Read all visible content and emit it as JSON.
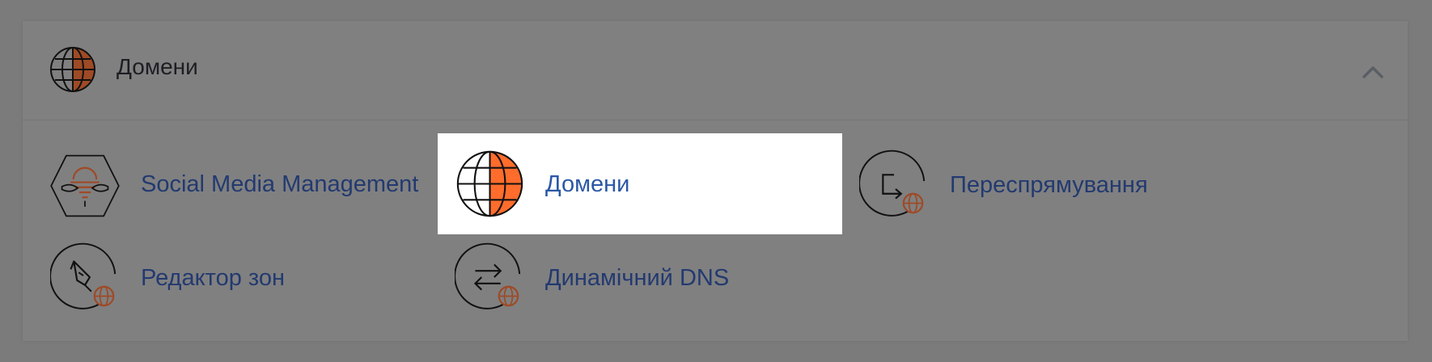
{
  "section": {
    "title": "Домени",
    "icon": "globe-icon",
    "collapse_icon": "chevron-up-icon"
  },
  "items": [
    {
      "label": "Social Media Management",
      "icon": "social-media-icon"
    },
    {
      "label": "Домени",
      "icon": "globe-icon",
      "highlighted": true
    },
    {
      "label": "Переспрямування",
      "icon": "redirect-icon"
    },
    {
      "label": "Редактор зон",
      "icon": "zone-editor-icon"
    },
    {
      "label": "Динамічний DNS",
      "icon": "dynamic-dns-icon"
    }
  ],
  "colors": {
    "accent": "#ff6c2c",
    "accent_dimmed": "#9e4a26",
    "link": "#2b58a6"
  }
}
